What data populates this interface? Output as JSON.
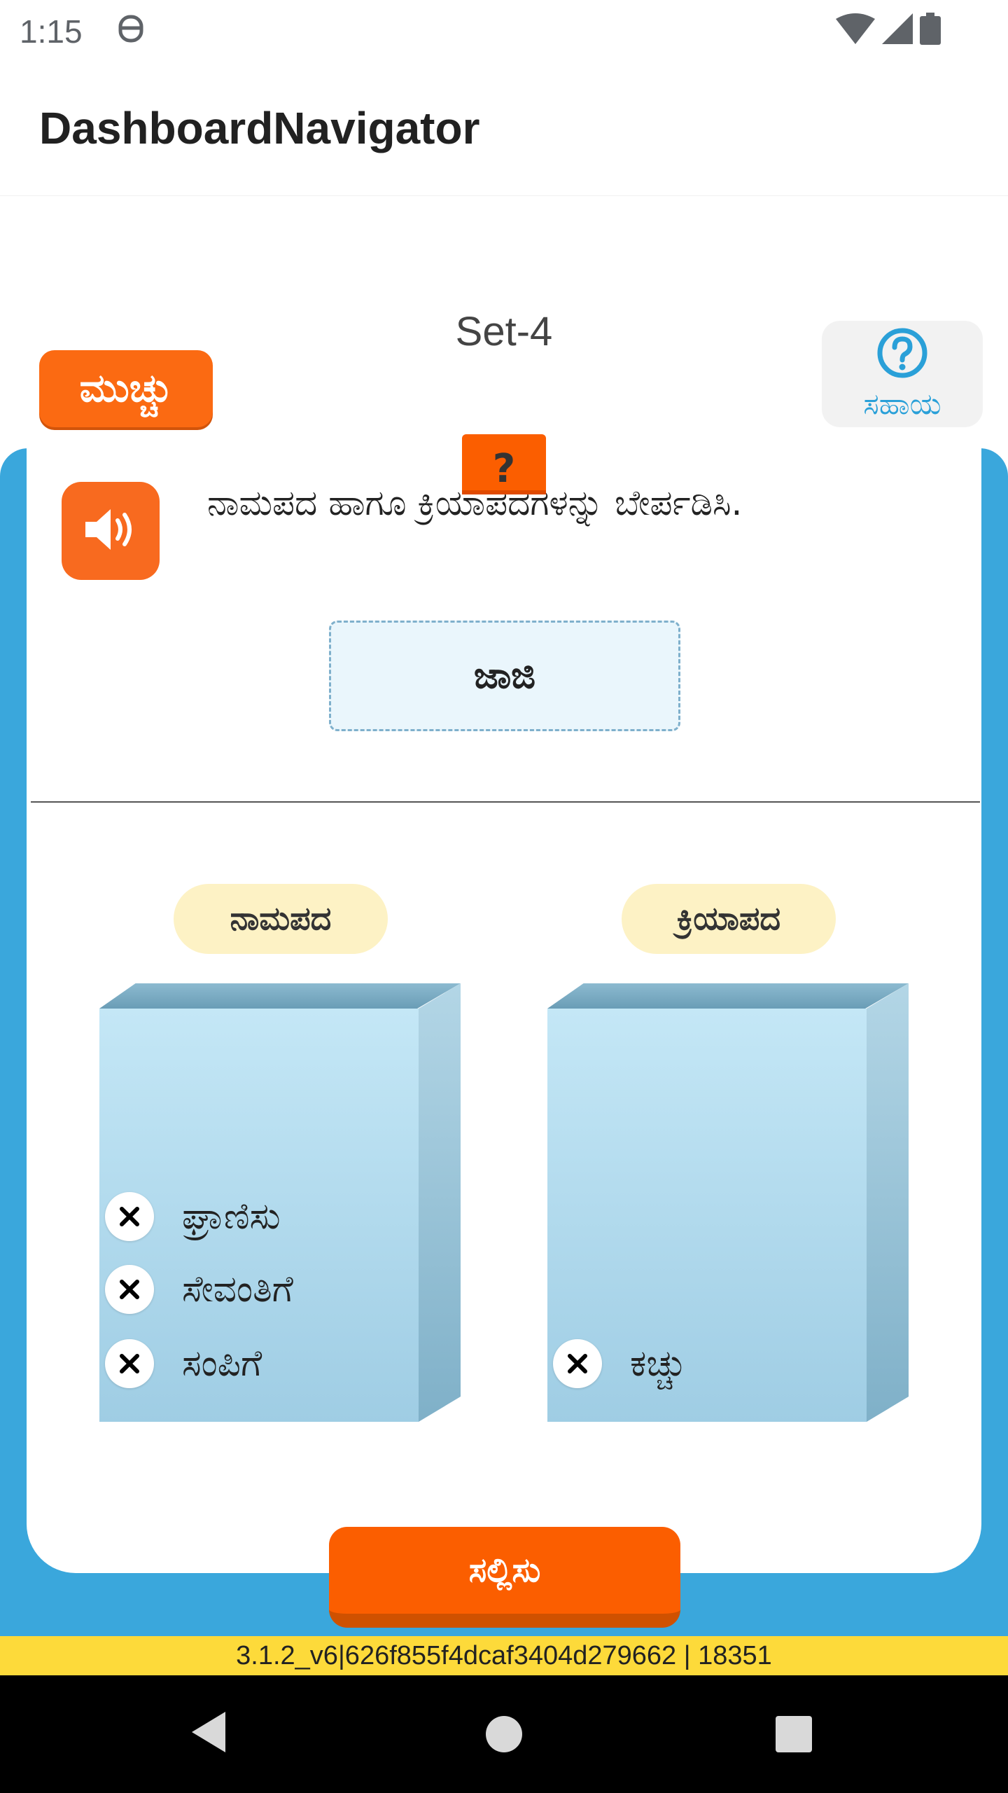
{
  "status_bar": {
    "time": "1:15"
  },
  "app_bar": {
    "title": "DashboardNavigator"
  },
  "activity": {
    "set_label": "Set-4",
    "close_label": "ಮುಚ್ಚು",
    "help_label": "ಸಹಾಯ",
    "question_badge": "?",
    "question_text": "ನಾಮಪದ ಹಾಗೂ ಕ್ರಿಯಾಪದಗಳನ್ನು ಬೇರ್ಪಡಿಸಿ.",
    "current_word": "ಜಾಜಿ",
    "categories": [
      {
        "label": "ನಾಮಪದ",
        "items": [
          "ಘ್ರಾಣಿಸು",
          "ಸೇವಂತಿಗೆ",
          "ಸಂಪಿಗೆ"
        ]
      },
      {
        "label": "ಕ್ರಿಯಾಪದ",
        "items": [
          "ಕಚ್ಚು"
        ]
      }
    ],
    "submit_label": "ಸಲ್ಲಿಸು"
  },
  "version_text": "3.1.2_v6|626f855f4dcaf3404d279662 | 18351",
  "icons": {
    "status": [
      "app-notification-icon",
      "wifi-icon",
      "signal-icon",
      "battery-icon"
    ],
    "help": "question-circle-icon",
    "speaker": "speaker-icon",
    "remove": "close-x-icon",
    "nav": [
      "back-icon",
      "home-icon",
      "recents-icon"
    ]
  },
  "colors": {
    "accent_orange": "#fb5e00",
    "background_blue": "#3aa7dc",
    "version_bar": "#fdda3a",
    "category_label": "#fdf2c5"
  }
}
